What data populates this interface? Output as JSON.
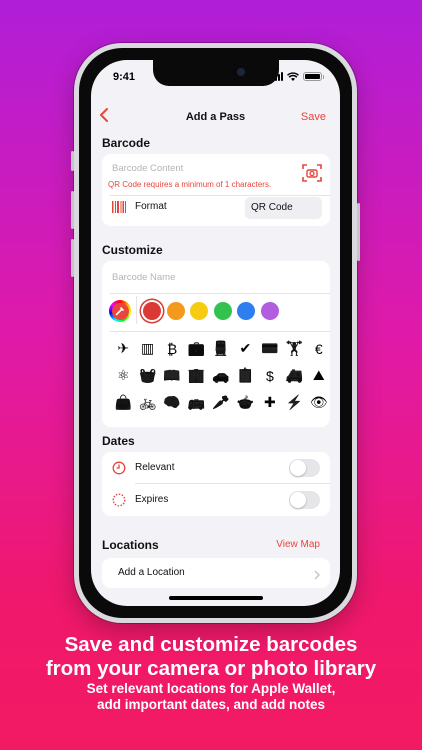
{
  "status": {
    "time": "9:41"
  },
  "nav": {
    "back_icon": "chevron-left-icon",
    "title": "Add a Pass",
    "save": "Save"
  },
  "barcode": {
    "header": "Barcode",
    "content_placeholder": "Barcode Content",
    "error": "QR Code requires a minimum of 1 characters.",
    "format_label": "Format",
    "format_value": "QR Code"
  },
  "customize": {
    "header": "Customize",
    "name_placeholder": "Barcode Name",
    "colors": [
      "#d93a33",
      "#f39a1d",
      "#f5cc12",
      "#34c24f",
      "#2f7ef0",
      "#b25de0"
    ],
    "icons": [
      [
        "✈",
        "▥",
        "₿",
        "💼",
        "🚆",
        "✔",
        "💳",
        "🏋",
        "€"
      ],
      [
        "⚛",
        "🧺",
        "📖",
        "🏢",
        "🚗",
        "📋",
        "$",
        "🚑",
        "⛰"
      ],
      [
        "👜",
        "🚲",
        "🧠",
        "🚌",
        "🥕",
        "🍲",
        "✚",
        "⚡",
        "👁"
      ]
    ]
  },
  "dates": {
    "header": "Dates",
    "relevant": "Relevant",
    "expires": "Expires"
  },
  "locations": {
    "header": "Locations",
    "view_map": "View Map",
    "add": "Add a Location"
  },
  "caption": {
    "title_line1": "Save and customize barcodes",
    "title_line2": "from your camera or photo library",
    "sub_line1": "Set relevant locations for Apple Wallet,",
    "sub_line2": "add important dates, and add notes"
  },
  "colors": {
    "accent": "#e8453c",
    "background_top": "#b01ed8",
    "background_bottom": "#f21a62"
  }
}
